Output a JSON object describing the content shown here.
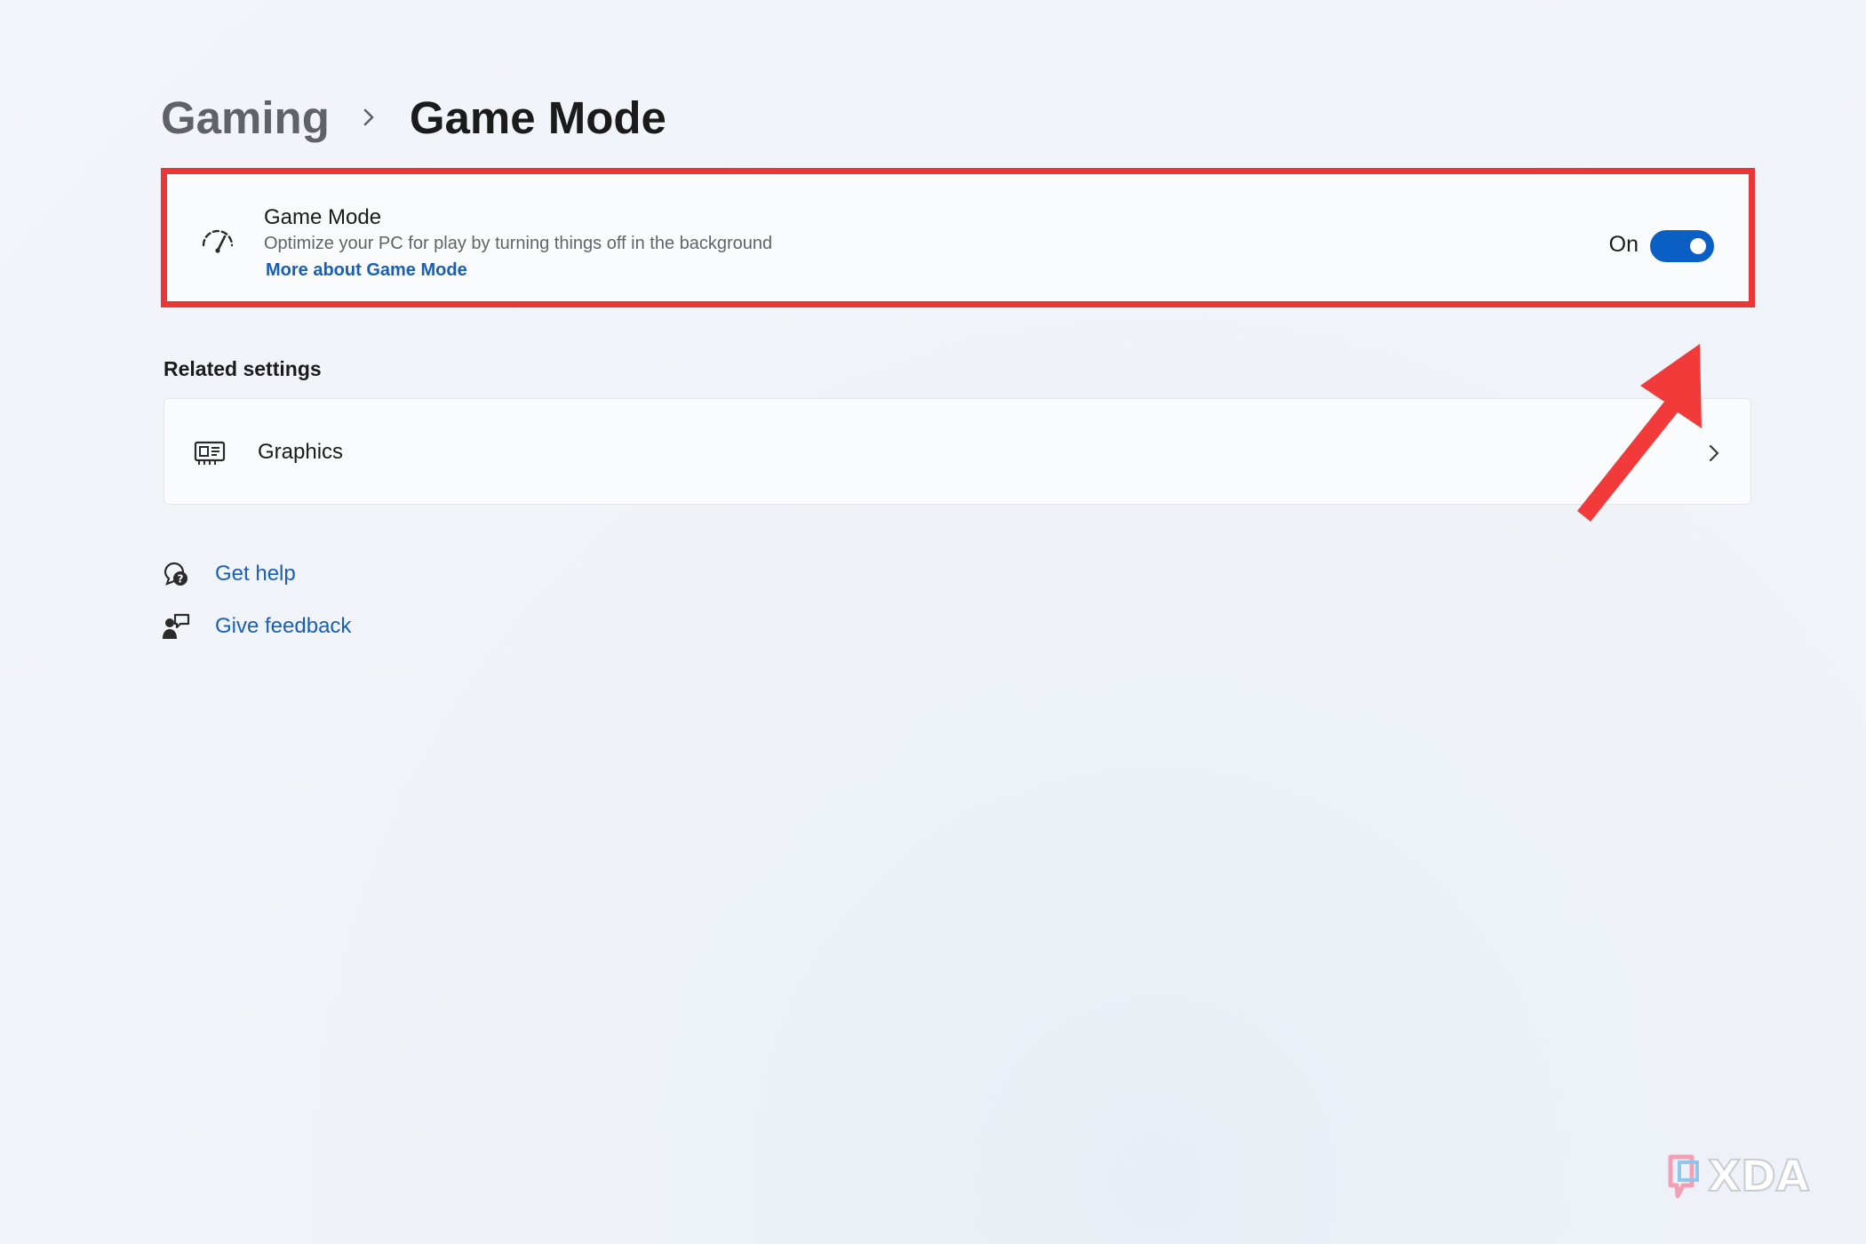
{
  "breadcrumb": {
    "parent": "Gaming",
    "separator_icon": "chevron-right-icon",
    "current": "Game Mode"
  },
  "game_mode": {
    "icon": "speedometer-icon",
    "title": "Game Mode",
    "description": "Optimize your PC for play by turning things off in the background",
    "link": "More about Game Mode",
    "state_label": "On",
    "toggle_on": true,
    "highlight_color": "#ee3535",
    "accent_color": "#0a5ec4"
  },
  "related_settings": {
    "heading": "Related settings",
    "items": [
      {
        "icon": "graphics-card-icon",
        "label": "Graphics",
        "chevron_icon": "chevron-right-icon"
      }
    ]
  },
  "help": {
    "get_help": {
      "icon": "help-chat-icon",
      "label": "Get help"
    },
    "give_feedback": {
      "icon": "feedback-icon",
      "label": "Give feedback"
    }
  },
  "overlay": {
    "arrow_icon": "red-arrow-icon",
    "arrow_color": "#f23a3a"
  },
  "watermark": {
    "text": "XDA"
  }
}
